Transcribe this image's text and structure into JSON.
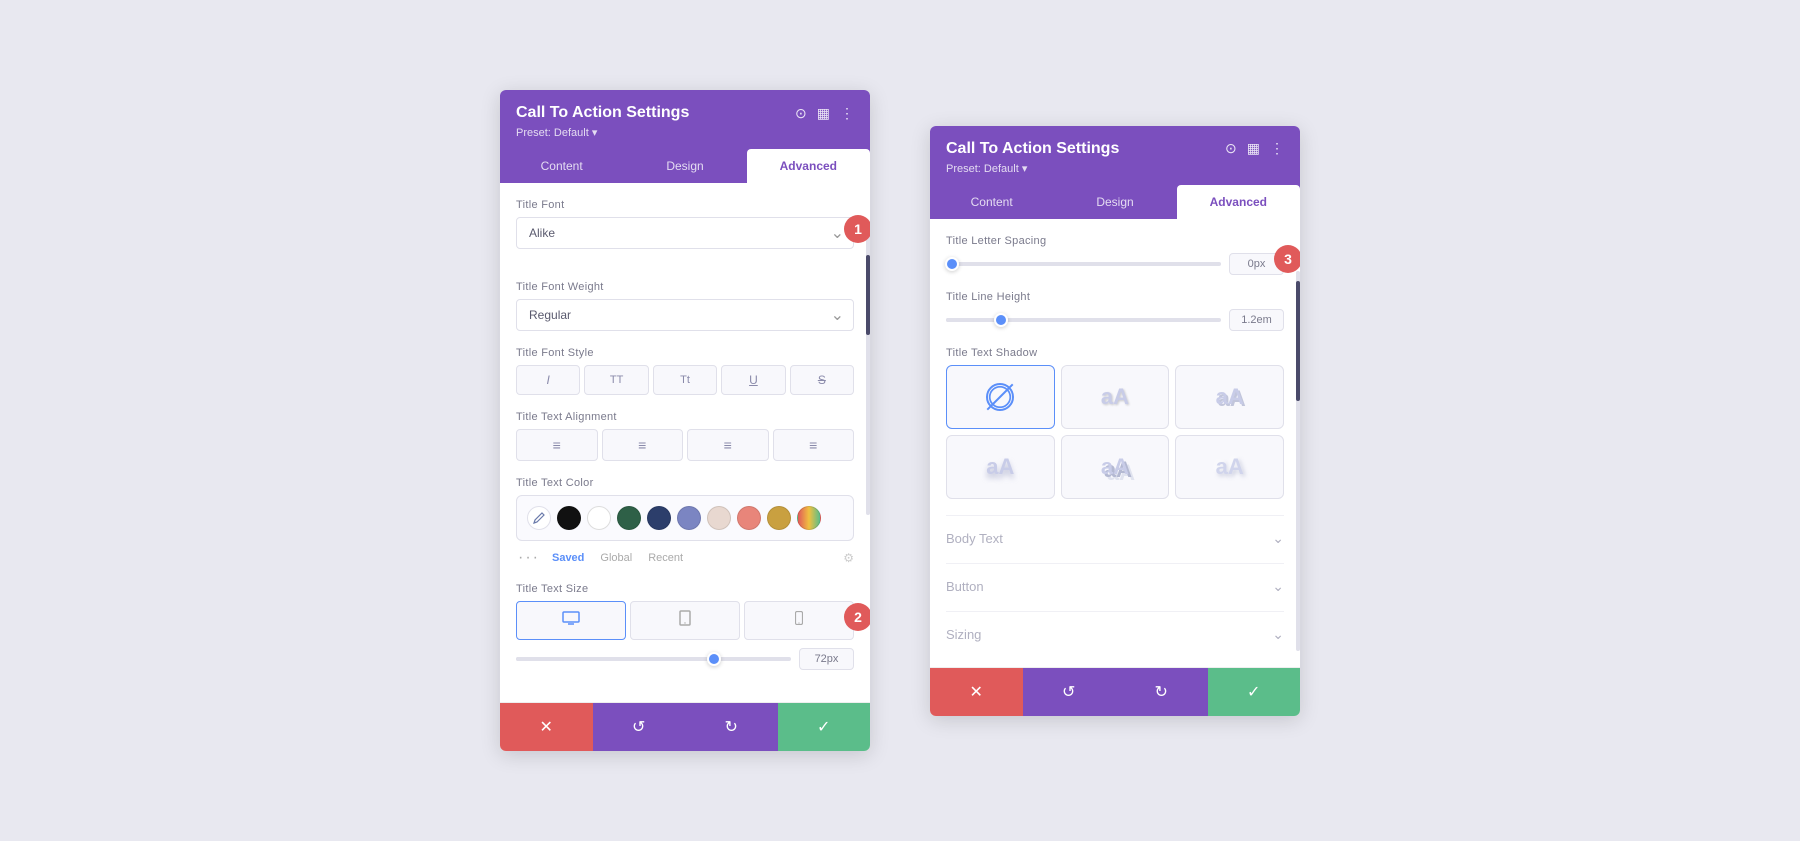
{
  "panel1": {
    "title": "Call To Action Settings",
    "preset": "Preset: Default ▾",
    "tabs": [
      "Content",
      "Design",
      "Advanced"
    ],
    "active_tab": "Advanced",
    "fields": {
      "title_font_label": "Title Font",
      "title_font_value": "Alike",
      "title_font_weight_label": "Title Font Weight",
      "title_font_weight_value": "Regular",
      "title_font_style_label": "Title Font Style",
      "title_text_alignment_label": "Title Text Alignment",
      "title_text_color_label": "Title Text Color",
      "title_text_size_label": "Title Text Size",
      "size_value": "72px",
      "color_saved": "Saved",
      "color_global": "Global",
      "color_recent": "Recent"
    },
    "badge": "1",
    "badge2": "2",
    "footer": {
      "cancel": "✕",
      "reset": "↺",
      "redo": "↻",
      "save": "✓"
    }
  },
  "panel2": {
    "title": "Call To Action Settings",
    "preset": "Preset: Default ▾",
    "tabs": [
      "Content",
      "Design",
      "Advanced"
    ],
    "active_tab": "Advanced",
    "fields": {
      "title_letter_spacing_label": "Title Letter Spacing",
      "letter_spacing_value": "0px",
      "title_line_height_label": "Title Line Height",
      "line_height_value": "1.2em",
      "title_text_shadow_label": "Title Text Shadow"
    },
    "collapsible": [
      {
        "title": "Body Text",
        "collapsed": true
      },
      {
        "title": "Button",
        "collapsed": true
      },
      {
        "title": "Sizing",
        "collapsed": true
      }
    ],
    "badge": "3",
    "footer": {
      "cancel": "✕",
      "reset": "↺",
      "redo": "↻",
      "save": "✓"
    }
  }
}
